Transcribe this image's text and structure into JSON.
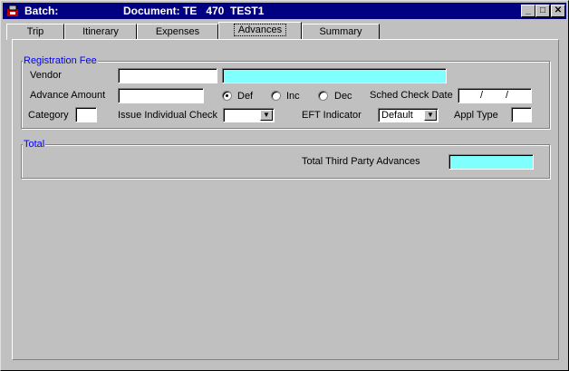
{
  "window": {
    "batch_label": "Batch:",
    "document_label": "Document: TE   470  TEST1",
    "minimize_glyph": "_",
    "maximize_glyph": "□",
    "close_glyph": "✕"
  },
  "tabs": [
    {
      "label": "Trip",
      "active": false
    },
    {
      "label": "Itinerary",
      "active": false
    },
    {
      "label": "Expenses",
      "active": false
    },
    {
      "label": "Advances",
      "active": true
    },
    {
      "label": "Summary",
      "active": false
    }
  ],
  "registration": {
    "legend": "Registration Fee",
    "vendor_label": "Vendor",
    "vendor_code": "",
    "vendor_name": "",
    "advance_amount_label": "Advance Amount",
    "advance_amount": "",
    "radio_def": "Def",
    "radio_inc": "Inc",
    "radio_dec": "Dec",
    "selected_radio": "Def",
    "sched_check_date_label": "Sched Check Date",
    "date_sep": "/",
    "category_label": "Category",
    "category": "",
    "issue_check_label": "Issue Individual Check",
    "issue_check_value": "",
    "eft_label": "EFT Indicator",
    "eft_value": "Default",
    "appl_type_label": "Appl Type",
    "appl_type": ""
  },
  "total": {
    "legend": "Total",
    "third_party_label": "Total Third Party Advances",
    "third_party_value": ""
  },
  "colors": {
    "titlebar": "#000080",
    "readonly_field": "#80ffff",
    "legend_text": "#0000ff"
  }
}
